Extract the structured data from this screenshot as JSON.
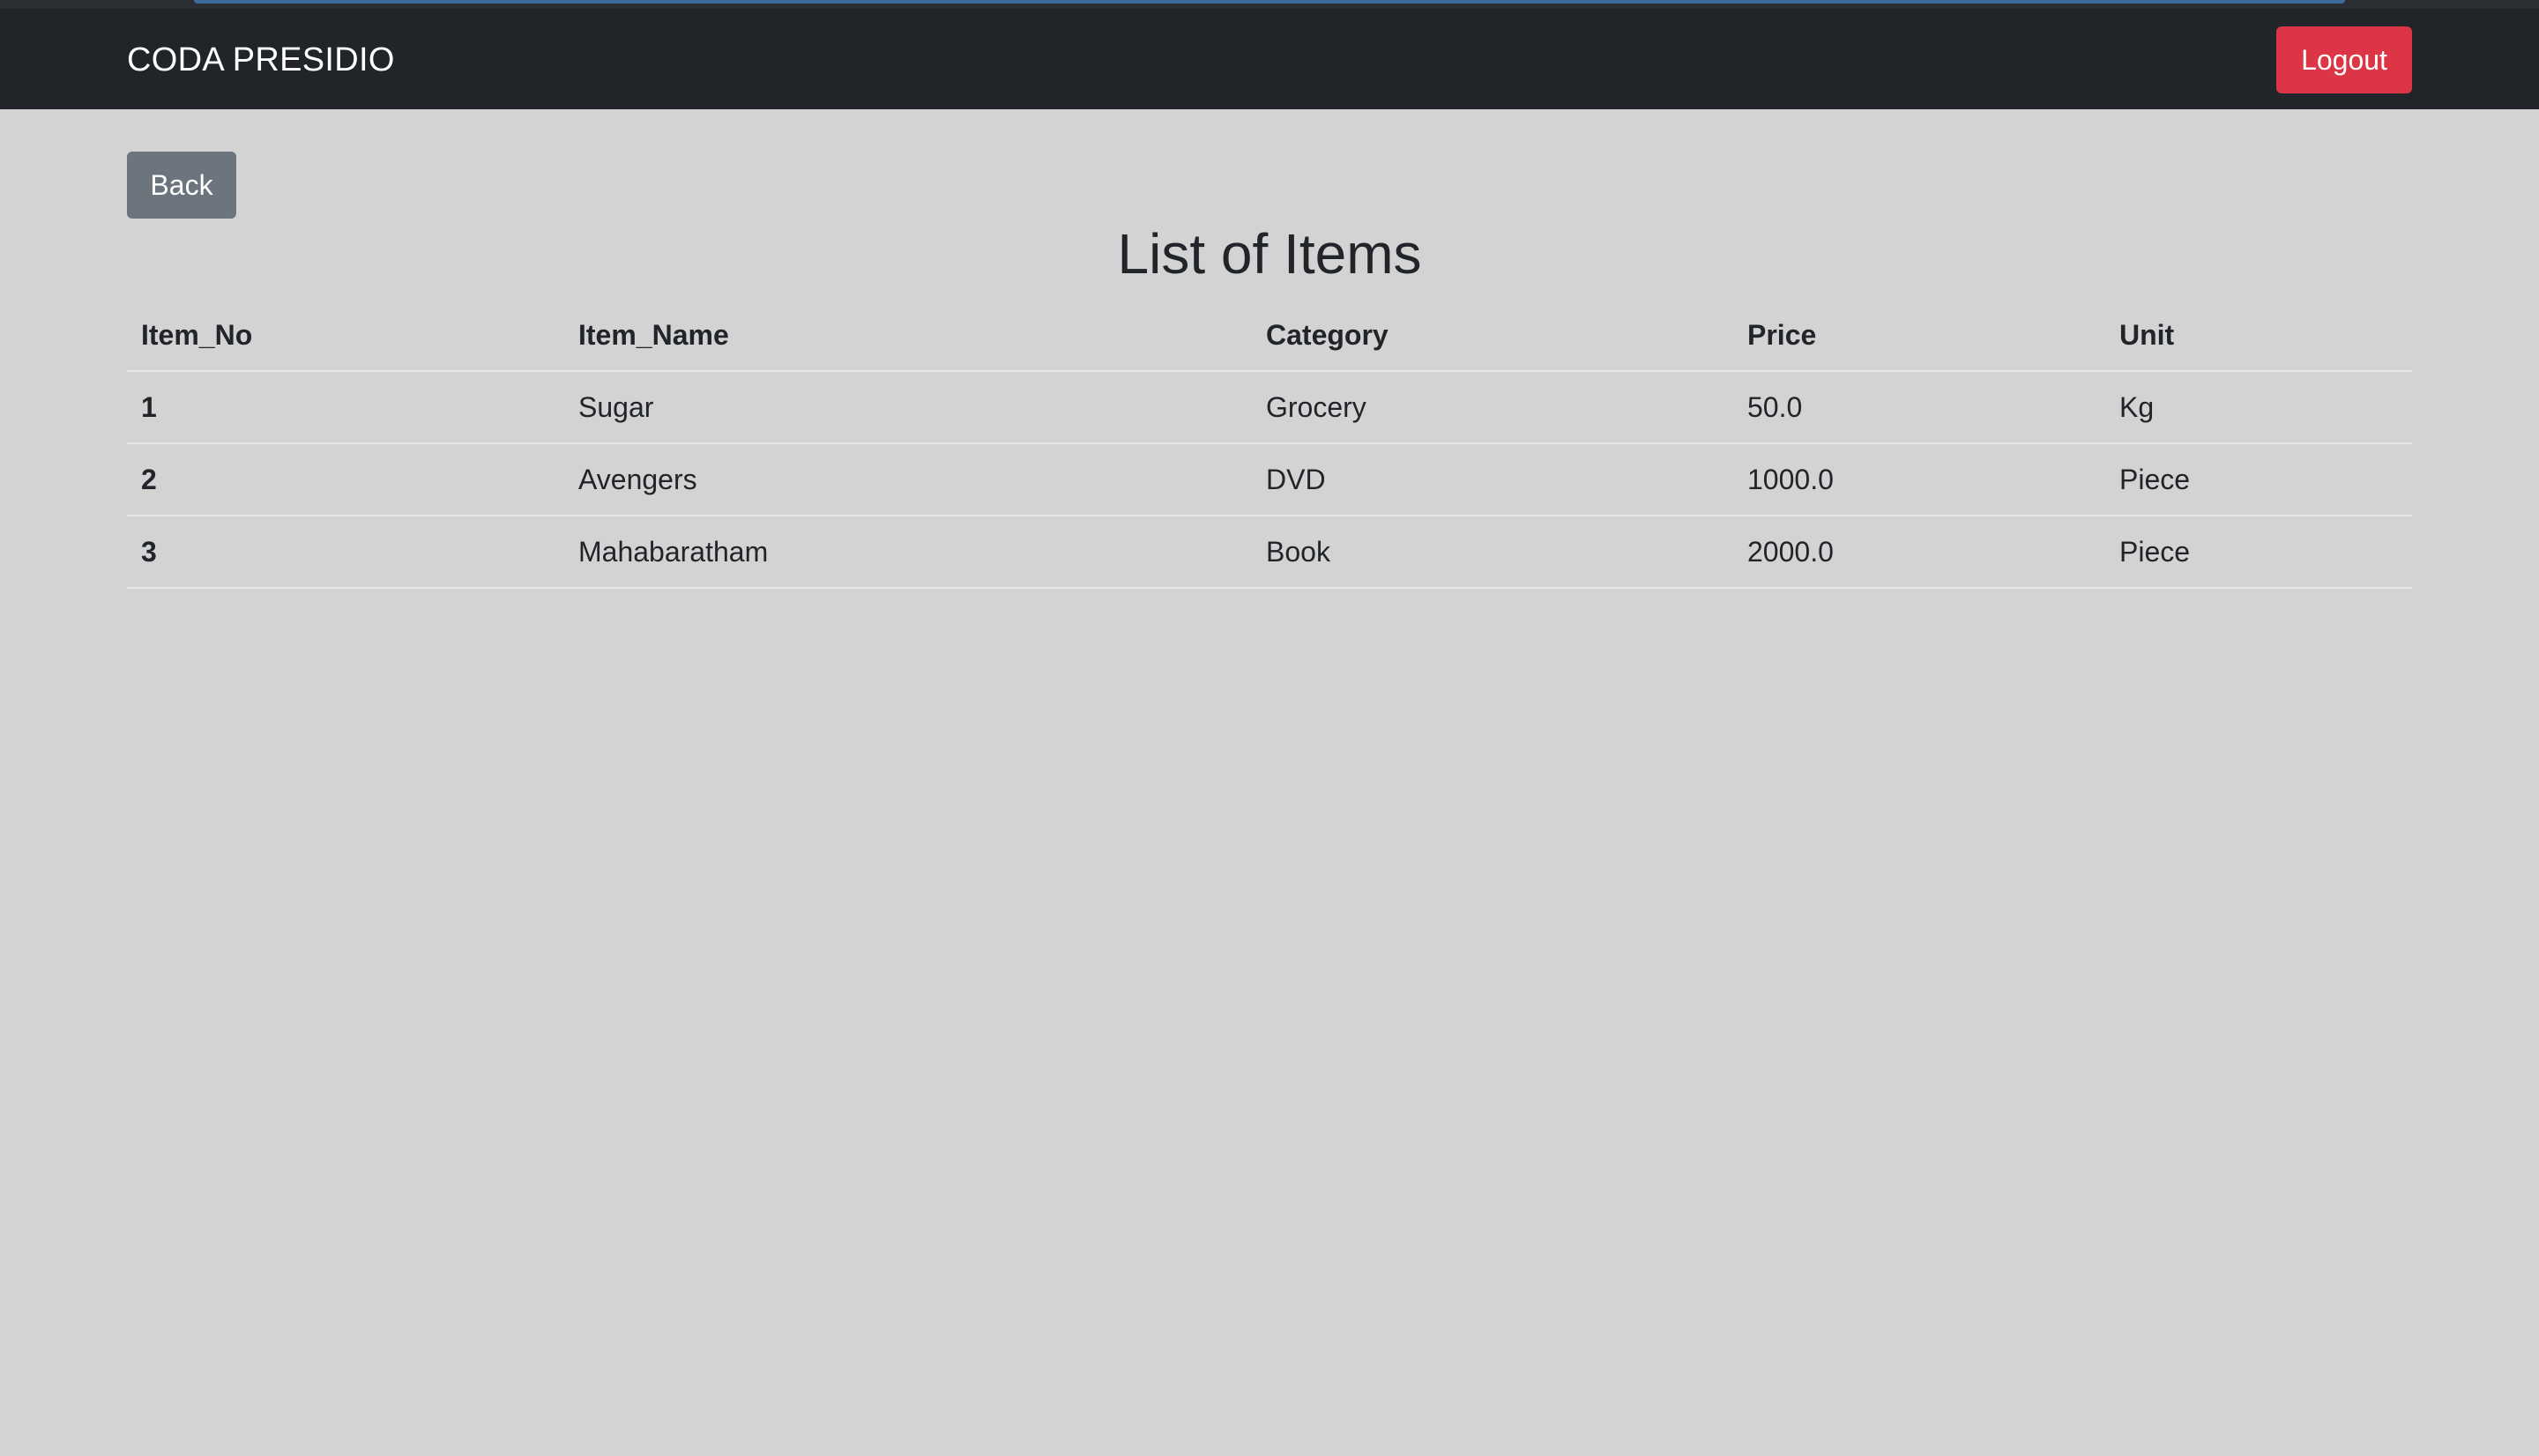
{
  "navbar": {
    "brand": "CODA PRESIDIO",
    "logout_label": "Logout"
  },
  "main": {
    "back_label": "Back",
    "title": "List of Items",
    "table": {
      "headers": [
        "Item_No",
        "Item_Name",
        "Category",
        "Price",
        "Unit"
      ],
      "rows": [
        [
          "1",
          "Sugar",
          "Grocery",
          "50.0",
          "Kg"
        ],
        [
          "2",
          "Avengers",
          "DVD",
          "1000.0",
          "Piece"
        ],
        [
          "3",
          "Mahabaratham",
          "Book",
          "2000.0",
          "Piece"
        ]
      ]
    }
  },
  "colors": {
    "navbar_bg": "#212529",
    "page_bg": "#d3d3d3",
    "logout_bg": "#dc3545",
    "back_bg": "#6c757d"
  }
}
